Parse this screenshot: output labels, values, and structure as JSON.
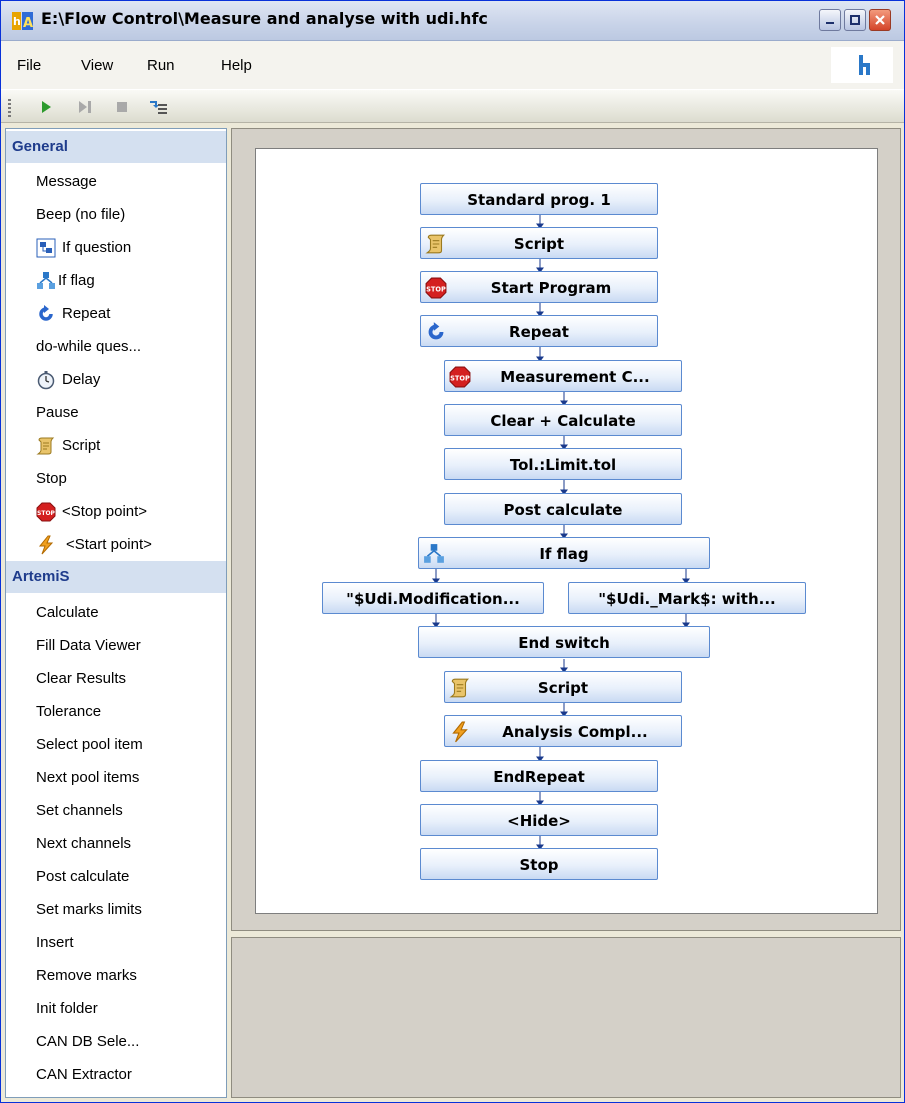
{
  "window": {
    "title": "E:\\Flow Control\\Measure and analyse with udi.hfc"
  },
  "menu": {
    "file": "File",
    "view": "View",
    "run": "Run",
    "help": "Help"
  },
  "sidebar": {
    "general_header": "General",
    "general_items": [
      {
        "label": "Message",
        "icon": null
      },
      {
        "label": "Beep (no file)",
        "icon": null
      },
      {
        "label": "If question",
        "icon": "if-question-icon"
      },
      {
        "label": "If flag",
        "icon": "if-flag-icon"
      },
      {
        "label": "Repeat",
        "icon": "repeat-icon"
      },
      {
        "label": "do-while ques...",
        "icon": null
      },
      {
        "label": "Delay",
        "icon": "stopwatch-icon"
      },
      {
        "label": "Pause",
        "icon": null
      },
      {
        "label": "Script",
        "icon": "script-scroll-icon"
      },
      {
        "label": "Stop",
        "icon": null
      },
      {
        "label": "<Stop point>",
        "icon": "stop-sign-icon"
      },
      {
        "label": "<Start point>",
        "icon": "lightning-icon"
      }
    ],
    "artemis_header": "ArtemiS",
    "artemis_items": [
      "Calculate",
      "Fill Data Viewer",
      "Clear Results",
      "Tolerance",
      "Select pool item",
      "Next pool items",
      "Set channels",
      "Next channels",
      "Post calculate",
      "Set marks limits",
      "Insert",
      "Remove marks",
      "Init folder",
      "CAN DB Sele...",
      "CAN Extractor"
    ]
  },
  "flow": {
    "nodes": [
      {
        "label": "Standard prog. 1",
        "icon": null
      },
      {
        "label": "Script",
        "icon": "script-scroll-icon"
      },
      {
        "label": "Start Program",
        "icon": "stop-sign-icon"
      },
      {
        "label": "Repeat",
        "icon": "repeat-icon"
      },
      {
        "label": "Measurement C...",
        "icon": "stop-sign-icon"
      },
      {
        "label": "Clear + Calculate",
        "icon": null
      },
      {
        "label": "Tol.:Limit.tol",
        "icon": null
      },
      {
        "label": "Post calculate",
        "icon": null
      },
      {
        "label": "If flag",
        "icon": "if-flag-icon"
      },
      {
        "label": "\"$Udi.Modification...",
        "icon": null
      },
      {
        "label": "\"$Udi._Mark$: with...",
        "icon": null
      },
      {
        "label": "End switch",
        "icon": null
      },
      {
        "label": "Script",
        "icon": "script-scroll-icon"
      },
      {
        "label": "Analysis Compl...",
        "icon": "lightning-icon"
      },
      {
        "label": "EndRepeat",
        "icon": null
      },
      {
        "label": "<Hide>",
        "icon": null
      },
      {
        "label": "Stop",
        "icon": null
      }
    ]
  },
  "colors": {
    "node_border": "#5b8ad0",
    "connector": "#1a3a8c",
    "section_header_text": "#1f3c8c"
  }
}
